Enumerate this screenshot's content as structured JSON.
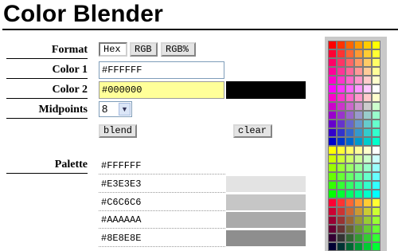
{
  "app": {
    "title": "Color Blender"
  },
  "form": {
    "format_label": "Format",
    "format_options": [
      "Hex",
      "RGB",
      "RGB%"
    ],
    "format_selected": "Hex",
    "color1_label": "Color 1",
    "color1_value": "#FFFFFF",
    "color2_label": "Color 2",
    "color2_value": "#000000",
    "color2_swatch": "#000000",
    "midpoints_label": "Midpoints",
    "midpoints_value": "8",
    "blend_label": "blend",
    "clear_label": "clear"
  },
  "palette": {
    "label": "Palette",
    "entries": [
      {
        "hex": "#FFFFFF",
        "color": "#FFFFFF"
      },
      {
        "hex": "#E3E3E3",
        "color": "#E3E3E3"
      },
      {
        "hex": "#C6C6C6",
        "color": "#C6C6C6"
      },
      {
        "hex": "#AAAAAA",
        "color": "#AAAAAA"
      },
      {
        "hex": "#8E8E8E",
        "color": "#8E8E8E"
      }
    ]
  },
  "colors": {
    "active_field_bg": "#FFFF99",
    "picker_frame": "#C9C9C9"
  }
}
